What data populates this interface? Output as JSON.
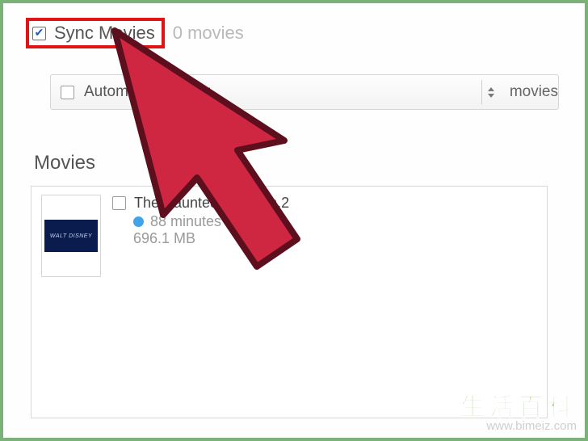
{
  "header": {
    "sync_label": "Sync Movies",
    "sync_checked": true,
    "sync_count_text": "0 movies"
  },
  "auto_include": {
    "checked": false,
    "prefix_text": "Automatically inclu",
    "trailing_text": "movies"
  },
  "section_title": "Movies",
  "movies": [
    {
      "checked": false,
      "title": "The.Haunted.Mansion.2",
      "duration": "88 minutes",
      "size": "696.1 MB",
      "thumb_text": "WALT DISNEY"
    }
  ],
  "watermark": {
    "zh": "生活百科",
    "url": "www.bimeiz.com"
  }
}
